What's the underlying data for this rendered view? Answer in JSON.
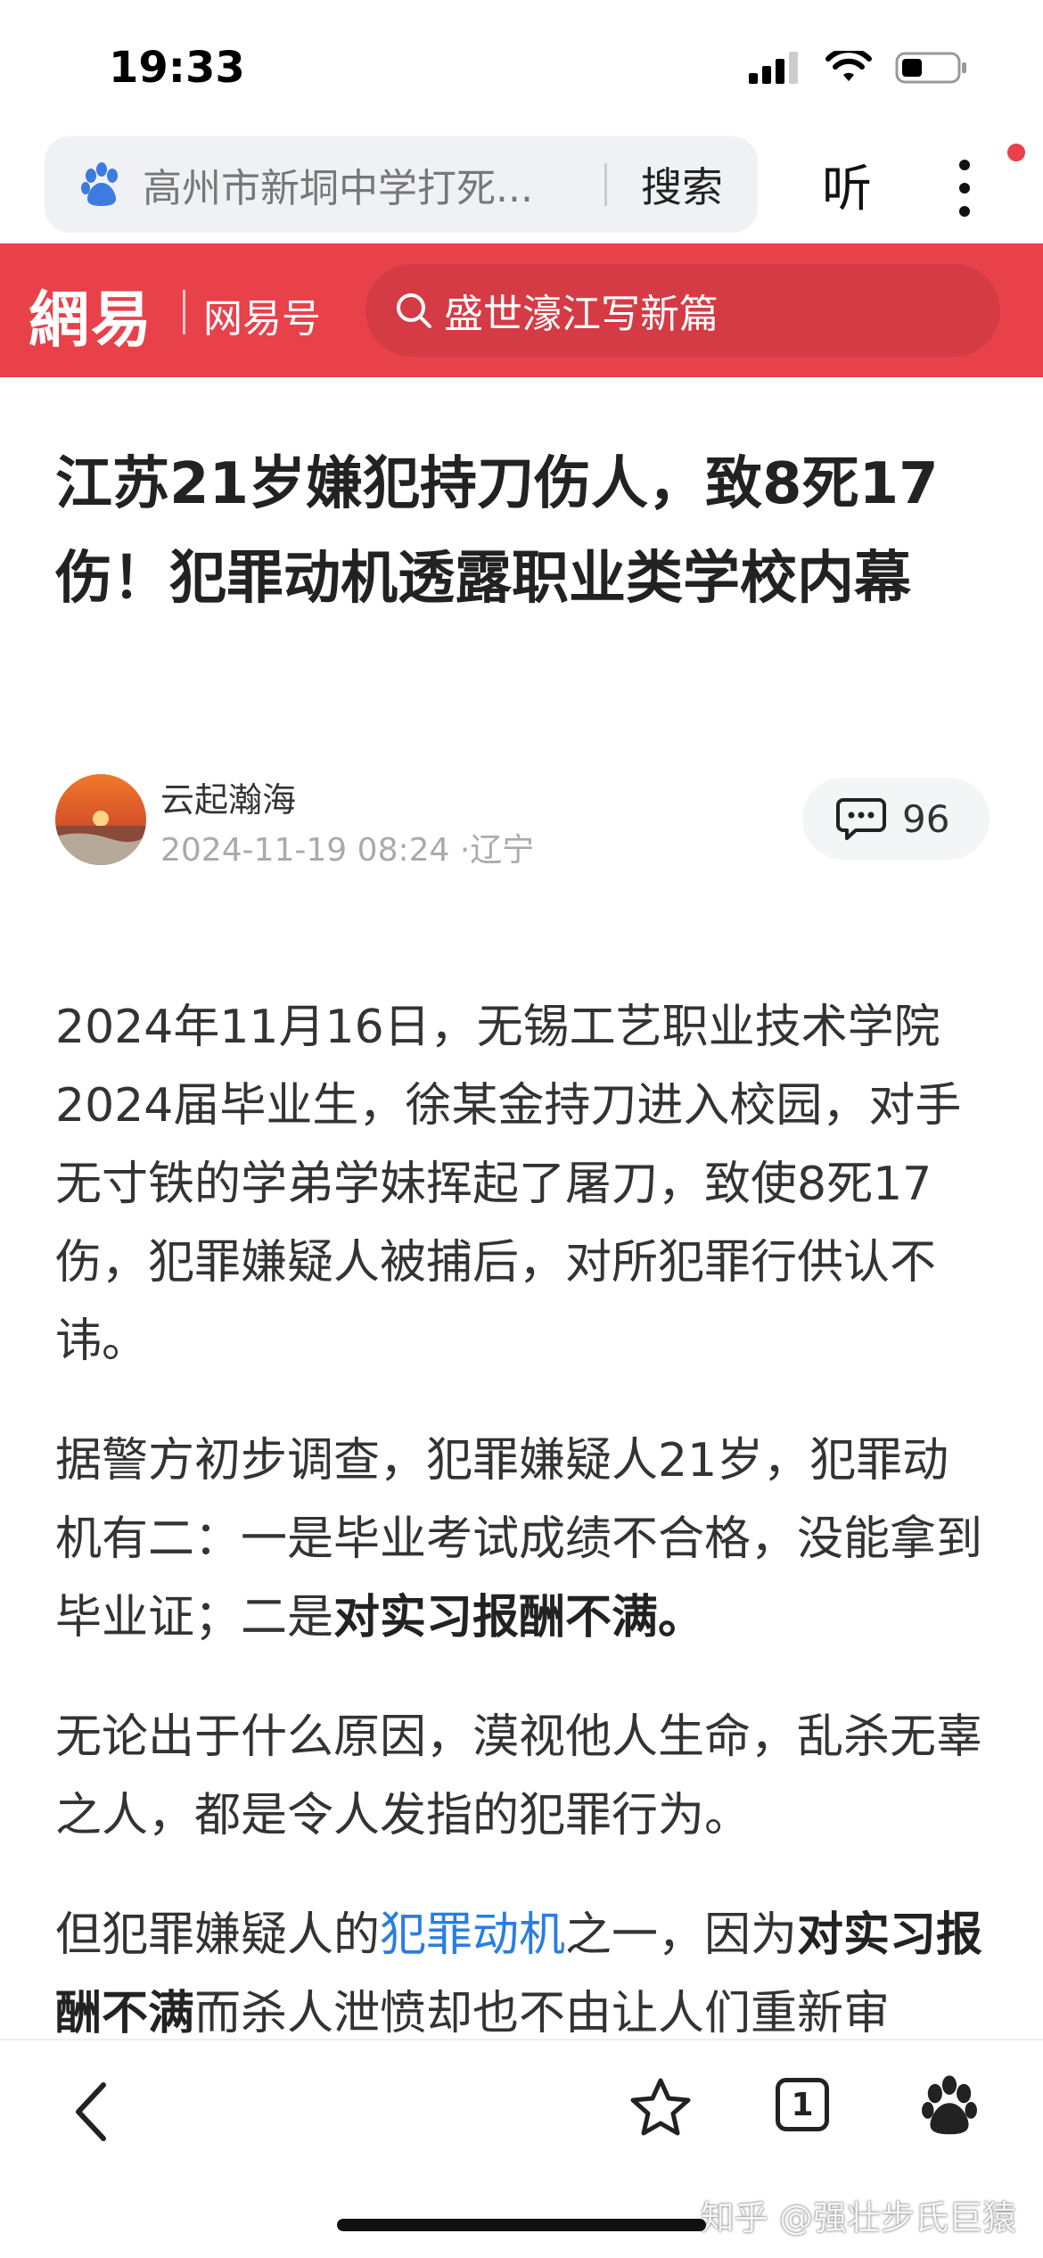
{
  "status_bar": {
    "time": "19:33"
  },
  "browser": {
    "search_query": "高州市新垌中学打死...",
    "search_button": "搜索",
    "listen_button": "听"
  },
  "netease": {
    "logo": "網易",
    "channel": "网易号",
    "search_placeholder": "盛世濠江写新篇",
    "brand_color": "#e8414a"
  },
  "article": {
    "title": "江苏21岁嫌犯持刀伤人，致8死17伤！犯罪动机透露职业类学校内幕",
    "author": "云起瀚海",
    "meta": "2024-11-19 08:24 ·辽宁",
    "comment_count": "96",
    "paragraphs": {
      "p1": "2024年11月16日，无锡工艺职业技术学院2024届毕业生，徐某金持刀进入校园，对手无寸铁的学弟学妹挥起了屠刀，致使8死17伤，犯罪嫌疑人被捕后，对所犯罪行供认不讳。",
      "p2_a": "据警方初步调查，犯罪嫌疑人21岁，犯罪动机有二：一是毕业考试成绩不合格，没能拿到毕业证；二是",
      "p2_b": "对实习报酬不满。",
      "p3": "无论出于什么原因，漠视他人生命，乱杀无辜之人，都是令人发指的犯罪行为。",
      "p4_a": "但犯罪嫌疑人的",
      "p4_link": "犯罪动机",
      "p4_b": "之一，因为",
      "p4_c": "对实习报酬不满",
      "p4_d": "而杀人泄愤却也不由让人们重新审"
    }
  },
  "toolbar": {
    "tab_count": "1"
  },
  "watermark": "知乎 @强壮步氏巨猿"
}
